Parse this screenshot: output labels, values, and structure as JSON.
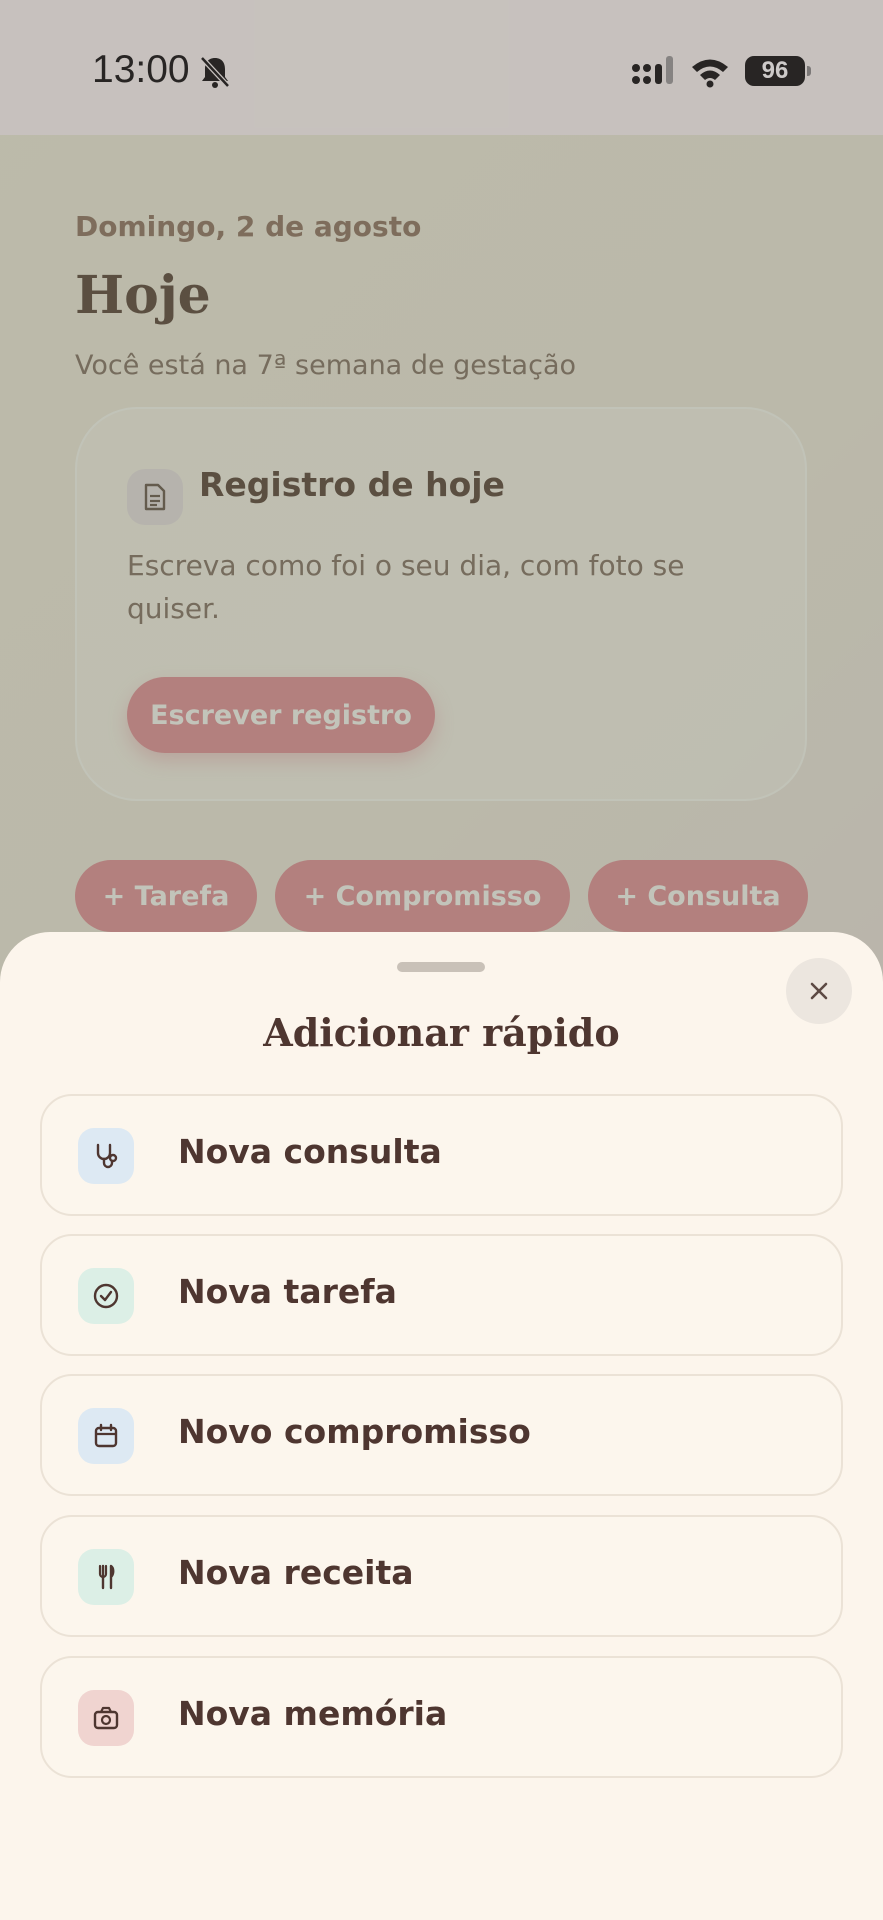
{
  "status_bar": {
    "time": "13:00",
    "battery": "96"
  },
  "background_page": {
    "date": "Domingo, 2 de agosto",
    "title": "Hoje",
    "subtitle": "Você está na 7ª semana de gestação",
    "card": {
      "title": "Registro de hoje",
      "text": "Escreva como foi o seu dia, com foto se quiser.",
      "button": "Escrever registro"
    },
    "chips": [
      "+ Tarefa",
      "+ Compromisso",
      "+ Consulta"
    ]
  },
  "sheet": {
    "title": "Adicionar rápido",
    "close_icon": "close-icon",
    "options": [
      {
        "label": "Nova consulta",
        "icon": "stethoscope-icon",
        "icon_bg": "#dde9f3"
      },
      {
        "label": "Nova tarefa",
        "icon": "check-circle-icon",
        "icon_bg": "#dcefe6"
      },
      {
        "label": "Novo compromisso",
        "icon": "calendar-icon",
        "icon_bg": "#dde9f3"
      },
      {
        "label": "Nova receita",
        "icon": "fork-knife-icon",
        "icon_bg": "#dcefe6"
      },
      {
        "label": "Nova memória",
        "icon": "camera-icon",
        "icon_bg": "#f0d4d0"
      }
    ]
  },
  "colors": {
    "accent": "#e58a98",
    "text_dark": "#4e3630",
    "sheet_bg": "#fcf5ec"
  }
}
